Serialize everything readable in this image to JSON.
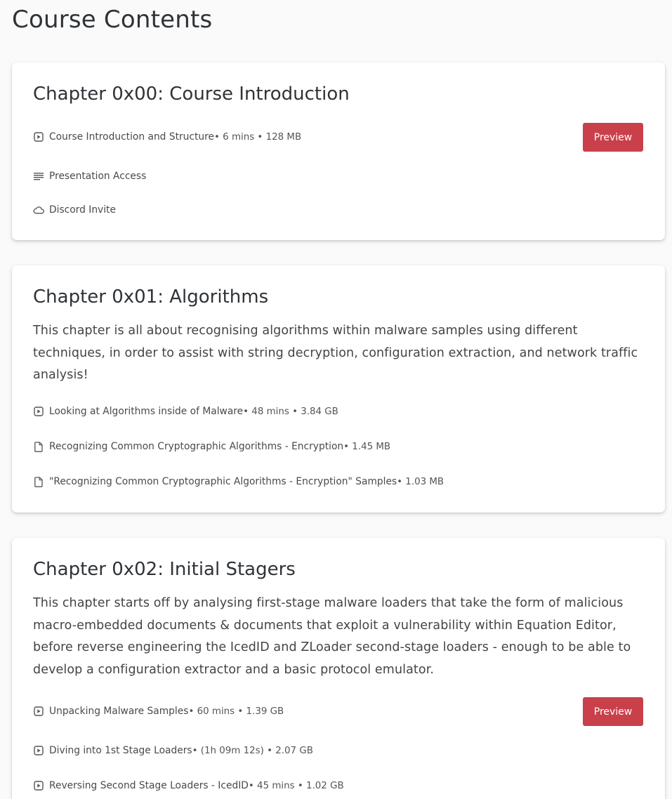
{
  "page": {
    "title": "Course Contents"
  },
  "chapters": [
    {
      "title": "Chapter 0x00: Course Introduction",
      "description": "",
      "lectures": [
        {
          "icon": "video-icon",
          "title": "Course Introduction and Structure",
          "meta": " • 6 mins • 128 MB",
          "preview_label": "Preview"
        },
        {
          "icon": "text-lines-icon",
          "title": "Presentation Access",
          "meta": ""
        },
        {
          "icon": "cloud-icon",
          "title": "Discord Invite",
          "meta": ""
        }
      ]
    },
    {
      "title": "Chapter 0x01: Algorithms",
      "description": "This chapter is all about recognising algorithms within malware samples using different techniques, in order to assist with string decryption, configuration extraction, and network traffic analysis!",
      "lectures": [
        {
          "icon": "video-icon",
          "title": "Looking at Algorithms inside of Malware",
          "meta": " • 48 mins • 3.84 GB"
        },
        {
          "icon": "file-icon",
          "title": "Recognizing Common Cryptographic Algorithms - Encryption",
          "meta": " • 1.45 MB"
        },
        {
          "icon": "file-icon",
          "title": "\"Recognizing Common Cryptographic Algorithms - Encryption\" Samples",
          "meta": " • 1.03 MB"
        }
      ]
    },
    {
      "title": "Chapter 0x02: Initial Stagers",
      "description": "This chapter starts off by analysing first-stage malware loaders that take the form of malicious macro-embedded documents & documents that exploit a vulnerability within Equation Editor, before reverse engineering the IcedID and ZLoader second-stage loaders - enough to be able to develop a configuration extractor and a basic protocol emulator.",
      "lectures": [
        {
          "icon": "video-icon",
          "title": "Unpacking Malware Samples",
          "meta": " • 60 mins • 1.39 GB",
          "preview_label": "Preview"
        },
        {
          "icon": "video-icon",
          "title": "Diving into 1st Stage Loaders",
          "meta": " • (1h 09m 12s) • 2.07 GB"
        },
        {
          "icon": "video-icon",
          "title": "Reversing Second Stage Loaders - IcedID",
          "meta": " • 45 mins • 1.02 GB"
        }
      ]
    }
  ]
}
